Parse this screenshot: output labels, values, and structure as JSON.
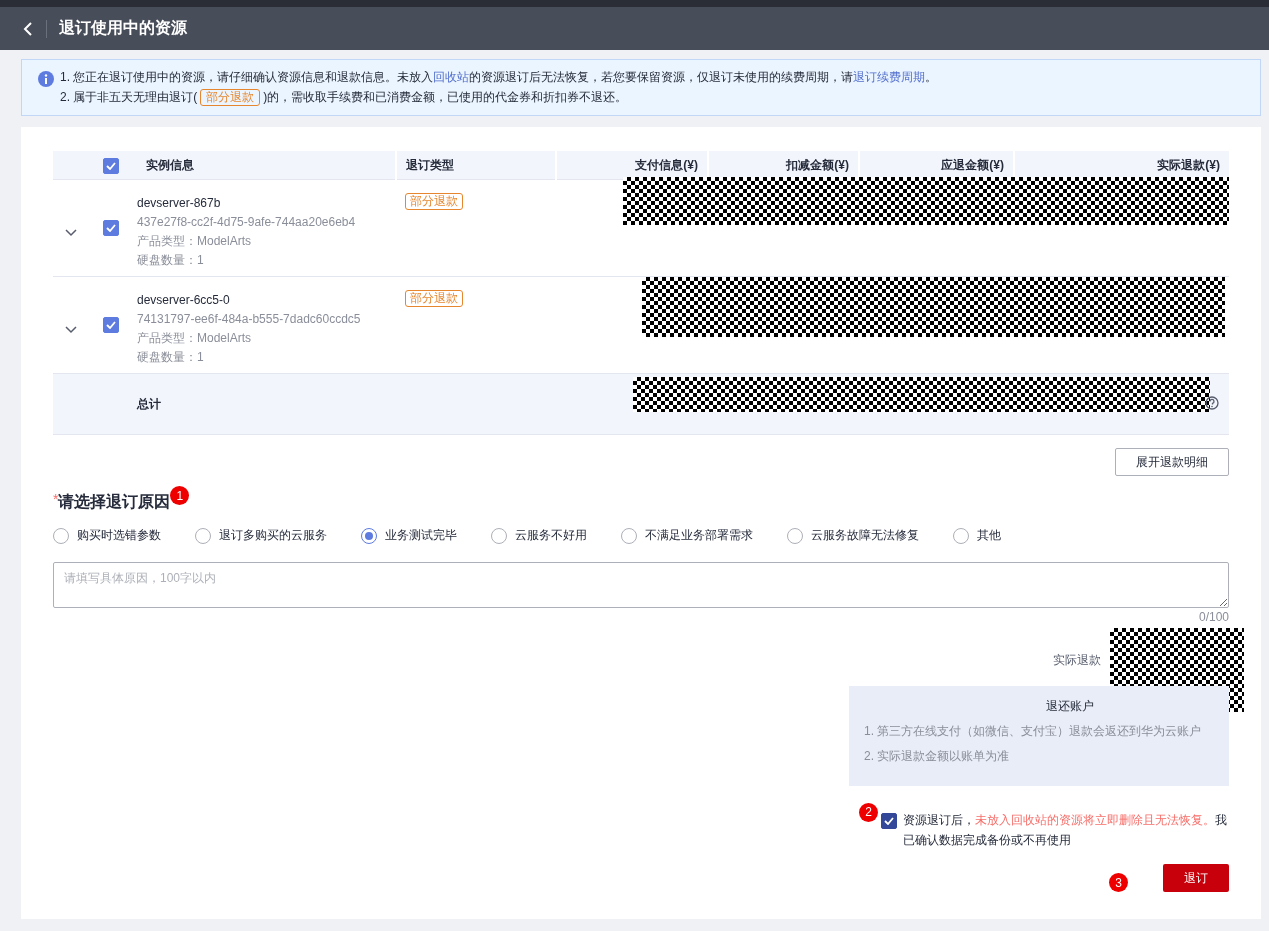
{
  "header": {
    "title": "退订使用中的资源"
  },
  "notice": {
    "lines": [
      [
        {
          "kind": "text",
          "text": "1. 您正在退订使用中的资源，请仔细确认资源信息和退款信息。未放入"
        },
        {
          "kind": "link",
          "text": "回收站"
        },
        {
          "kind": "text",
          "text": "的资源退订后无法恢复，若您要保留资源，仅退订未使用的续费周期，请"
        },
        {
          "kind": "link",
          "text": "退订续费周期"
        },
        {
          "kind": "text",
          "text": "。"
        }
      ],
      [
        {
          "kind": "text",
          "text": "2. 属于非五天无理由退订("
        },
        {
          "kind": "tag",
          "text": "部分退款"
        },
        {
          "kind": "text",
          "text": ")的，需收取手续费和已消费金额，已使用的代金券和折扣券不退还。"
        }
      ]
    ]
  },
  "table": {
    "all_checked": true,
    "columns": [
      {
        "kind": "text",
        "label": "实例信息"
      },
      {
        "kind": "text",
        "label": "退订类型"
      },
      {
        "kind": "money",
        "label": "支付信息(¥)"
      },
      {
        "kind": "money",
        "label": "扣减金额(¥)"
      },
      {
        "kind": "money",
        "label": "应退金额(¥)"
      },
      {
        "kind": "money",
        "label": "实际退款(¥)"
      }
    ],
    "rows": [
      {
        "name": "devserver-867b",
        "id": "437e27f8-cc2f-4d75-9afe-744aa20e6eb4",
        "product": "产品类型：ModelArts",
        "disks": "硬盘数量：1",
        "refund_type": "部分退款",
        "checked": true,
        "expanded": false
      },
      {
        "name": "devserver-6cc5-0",
        "id": "74131797-ee6f-484a-b555-7dadc60ccdc5",
        "product": "产品类型：ModelArts",
        "disks": "硬盘数量：1",
        "refund_type": "部分退款",
        "checked": true,
        "expanded": false
      }
    ],
    "total_label": "总计"
  },
  "expand_button": "展开退款明细",
  "reason": {
    "required_mark": "*",
    "title": "请选择退订原因",
    "step": "1",
    "options": [
      {
        "label": "购买时选错参数",
        "selected": false
      },
      {
        "label": "退订多购买的云服务",
        "selected": false
      },
      {
        "label": "业务测试完毕",
        "selected": true
      },
      {
        "label": "云服务不好用",
        "selected": false
      },
      {
        "label": "不满足业务部署需求",
        "selected": false
      },
      {
        "label": "云服务故障无法修复",
        "selected": false
      },
      {
        "label": "其他",
        "selected": false
      }
    ],
    "placeholder": "请填写具体原因，100字以内",
    "counter": "0/100"
  },
  "refund": {
    "actual_label": "实际退款",
    "account_label": "退还账户",
    "notes": [
      "1. 第三方在线支付（如微信、支付宝）退款会返还到华为云账户",
      "2. 实际退款金额以账单为准"
    ]
  },
  "confirm": {
    "checked": true,
    "step": "2",
    "parts": [
      {
        "kind": "text",
        "text": "资源退订后，"
      },
      {
        "kind": "warning",
        "text": "未放入回收站的资源将立即删除且无法恢复。"
      },
      {
        "kind": "text",
        "text": "我已确认数据完成备份或不再使用"
      }
    ]
  },
  "submit": {
    "label": "退订",
    "step": "3"
  }
}
